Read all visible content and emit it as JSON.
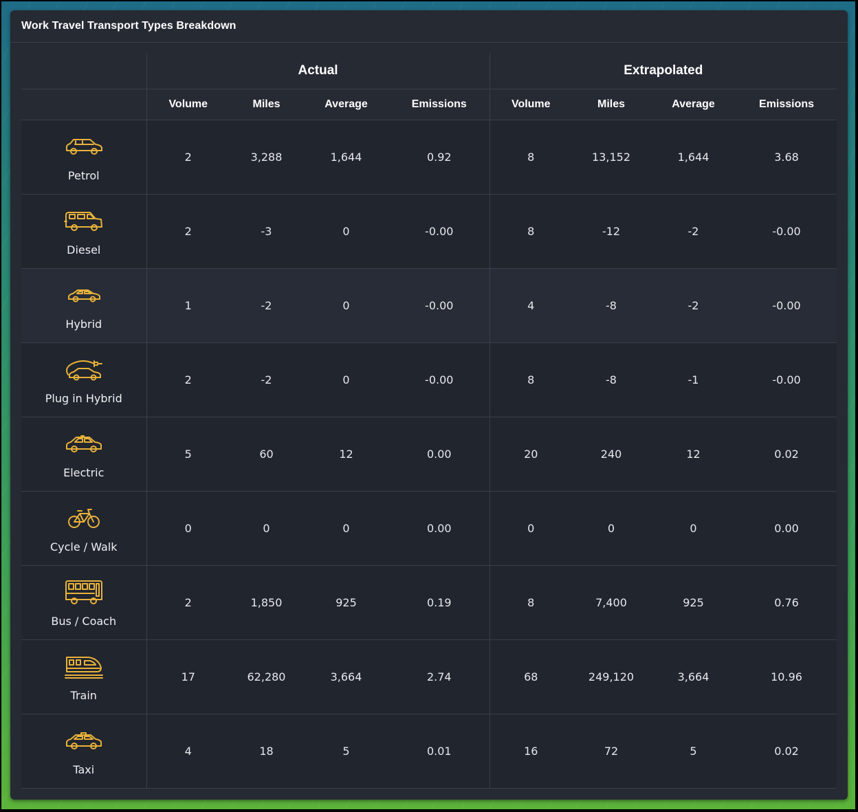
{
  "panel": {
    "title": "Work Travel Transport Types Breakdown"
  },
  "colors": {
    "icon": "#e8b23a",
    "panel_bg": "#262a33",
    "row_bg": "#21252e",
    "row_alt_bg": "#282c36"
  },
  "table": {
    "groups": [
      "Actual",
      "Extrapolated"
    ],
    "columns": [
      "Volume",
      "Miles",
      "Average",
      "Emissions"
    ],
    "rows": [
      {
        "label": "Petrol",
        "icon": "estate-car-icon",
        "actual": [
          "2",
          "3,288",
          "1,644",
          "0.92"
        ],
        "extrapolated": [
          "8",
          "13,152",
          "1,644",
          "3.68"
        ]
      },
      {
        "label": "Diesel",
        "icon": "suv-icon",
        "actual": [
          "2",
          "-3",
          "0",
          "-0.00"
        ],
        "extrapolated": [
          "8",
          "-12",
          "-2",
          "-0.00"
        ]
      },
      {
        "label": "Hybrid",
        "icon": "hatchback-car-icon",
        "actual": [
          "1",
          "-2",
          "0",
          "-0.00"
        ],
        "extrapolated": [
          "4",
          "-8",
          "-2",
          "-0.00"
        ]
      },
      {
        "label": "Plug in Hybrid",
        "icon": "plug-in-car-icon",
        "actual": [
          "2",
          "-2",
          "0",
          "-0.00"
        ],
        "extrapolated": [
          "8",
          "-8",
          "-1",
          "-0.00"
        ]
      },
      {
        "label": "Electric",
        "icon": "electric-car-icon",
        "actual": [
          "5",
          "60",
          "12",
          "0.00"
        ],
        "extrapolated": [
          "20",
          "240",
          "12",
          "0.02"
        ]
      },
      {
        "label": "Cycle / Walk",
        "icon": "bicycle-icon",
        "actual": [
          "0",
          "0",
          "0",
          "0.00"
        ],
        "extrapolated": [
          "0",
          "0",
          "0",
          "0.00"
        ]
      },
      {
        "label": "Bus / Coach",
        "icon": "bus-icon",
        "actual": [
          "2",
          "1,850",
          "925",
          "0.19"
        ],
        "extrapolated": [
          "8",
          "7,400",
          "925",
          "0.76"
        ]
      },
      {
        "label": "Train",
        "icon": "train-icon",
        "actual": [
          "17",
          "62,280",
          "3,664",
          "2.74"
        ],
        "extrapolated": [
          "68",
          "249,120",
          "3,664",
          "10.96"
        ]
      },
      {
        "label": "Taxi",
        "icon": "taxi-icon",
        "actual": [
          "4",
          "18",
          "5",
          "0.01"
        ],
        "extrapolated": [
          "16",
          "72",
          "5",
          "0.02"
        ]
      }
    ]
  }
}
